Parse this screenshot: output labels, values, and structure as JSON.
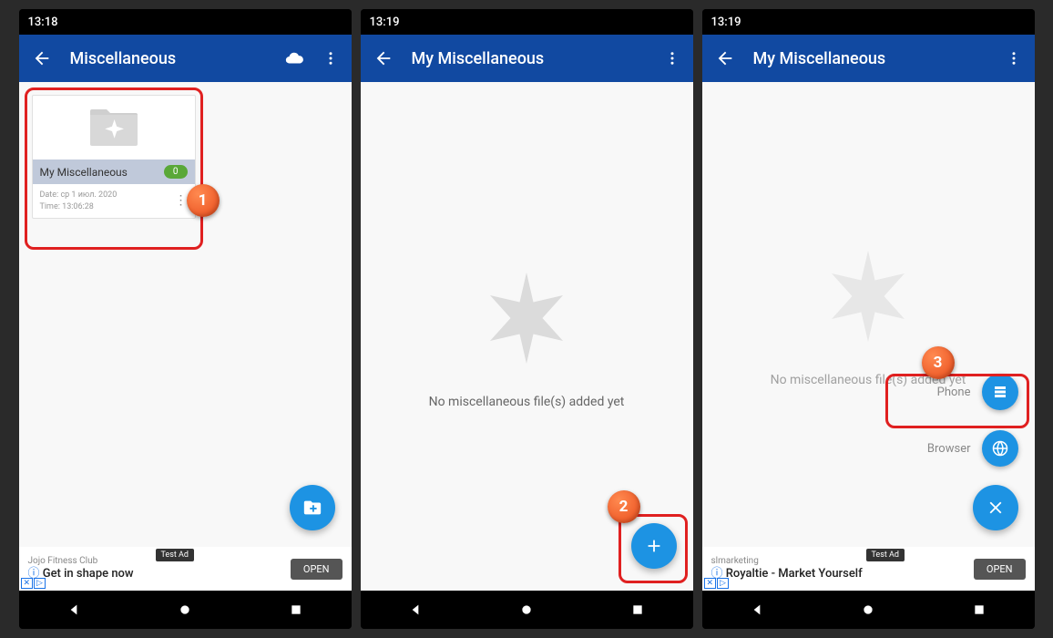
{
  "screens": [
    {
      "status": {
        "time": "13:18"
      },
      "appbar": {
        "title": "Miscellaneous"
      },
      "folder": {
        "name": "My Miscellaneous",
        "count": "0",
        "date_label": "Date:",
        "date": "ср 1 июл. 2020",
        "time_label": "Time:",
        "time": "13:06:28"
      },
      "ad": {
        "line1": "Jojo Fitness Club",
        "line2": "Get in shape now",
        "tag": "Test Ad",
        "open": "OPEN"
      },
      "marker": "1"
    },
    {
      "status": {
        "time": "13:19"
      },
      "appbar": {
        "title": "My Miscellaneous"
      },
      "empty_msg": "No miscellaneous file(s) added yet",
      "marker": "2"
    },
    {
      "status": {
        "time": "13:19"
      },
      "appbar": {
        "title": "My Miscellaneous"
      },
      "empty_msg": "No miscellaneous file(s) added yet",
      "options": {
        "phone": "Phone",
        "browser": "Browser"
      },
      "ad": {
        "line1": "slmarketing",
        "line2": "Royaltie - Market Yourself",
        "tag": "Test Ad",
        "open": "OPEN"
      },
      "marker": "3"
    }
  ]
}
